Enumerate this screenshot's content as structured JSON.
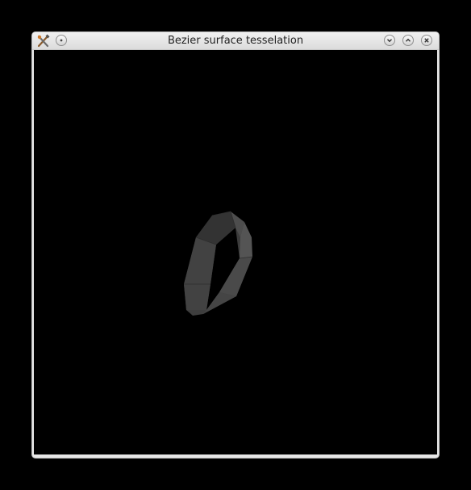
{
  "window": {
    "title": "Bezier surface tesselation"
  },
  "titlebar": {
    "icons": [
      "app-tools-icon",
      "menu-dot-icon",
      "minimize-icon",
      "maximize-icon",
      "close-icon"
    ]
  },
  "colors": {
    "titlebar": "#e6e6e6",
    "canvas_background": "#000000",
    "surface_dark": "#3a3a3a",
    "surface_mid": "#4a4a4a",
    "surface_light": "#5a5a5a"
  }
}
